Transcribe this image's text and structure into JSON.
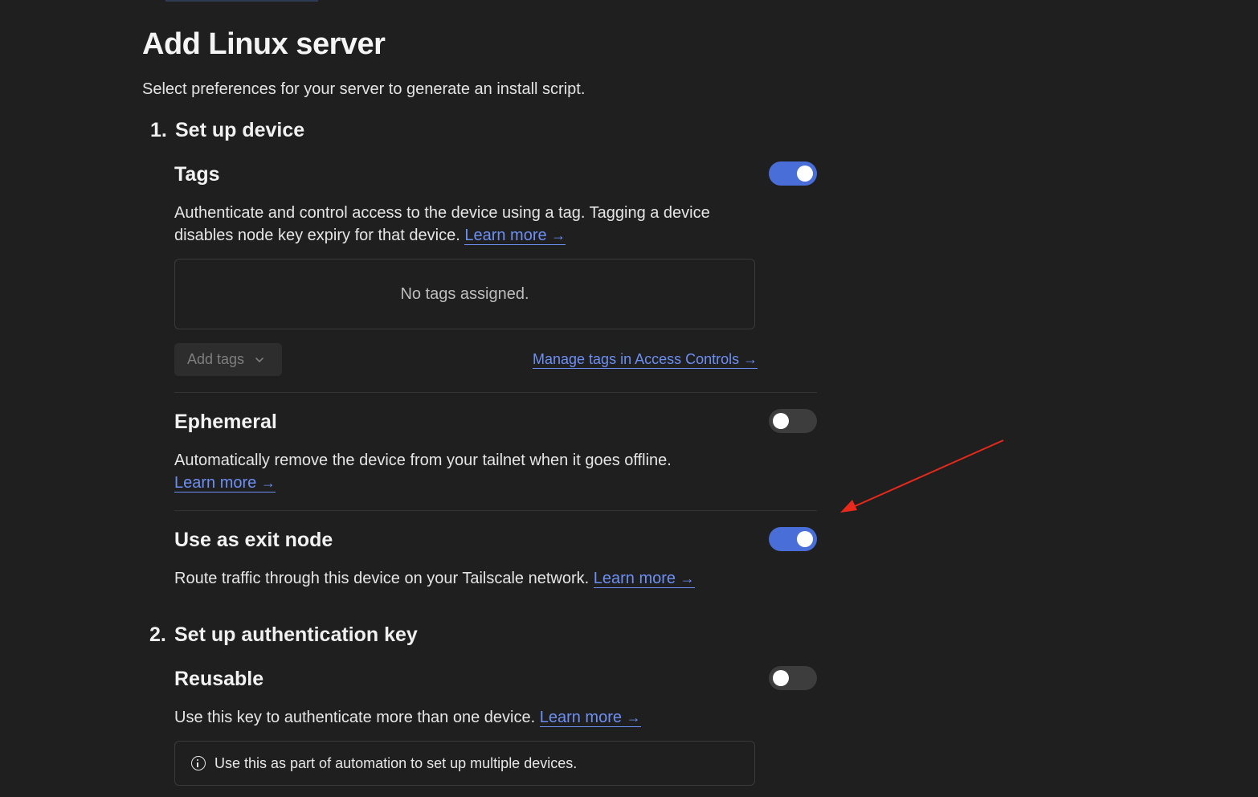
{
  "page": {
    "title": "Add Linux server",
    "subtitle": "Select preferences for your server to generate an install script."
  },
  "step1": {
    "number": "1.",
    "title": "Set up device"
  },
  "tags": {
    "title": "Tags",
    "description": "Authenticate and control access to the device using a tag. Tagging a device disables node key expiry for that device.",
    "learn_more": "Learn more",
    "enabled": true,
    "empty_text": "No tags assigned.",
    "add_button": "Add tags",
    "manage_link": "Manage tags in Access Controls"
  },
  "ephemeral": {
    "title": "Ephemeral",
    "description": "Automatically remove the device from your tailnet when it goes offline.",
    "learn_more": "Learn more",
    "enabled": false
  },
  "exit_node": {
    "title": "Use as exit node",
    "description": "Route traffic through this device on your Tailscale network.",
    "learn_more": "Learn more",
    "enabled": true
  },
  "step2": {
    "number": "2.",
    "title": "Set up authentication key"
  },
  "reusable": {
    "title": "Reusable",
    "description": "Use this key to authenticate more than one device.",
    "learn_more": "Learn more",
    "enabled": false,
    "info_text": "Use this as part of automation to set up multiple devices."
  },
  "icons": {
    "arrow": "arrow-right-icon",
    "chevron": "chevron-down-icon",
    "info": "info-circle-icon",
    "annotation": "red-annotation-arrow"
  },
  "colors": {
    "background": "#1f1f1f",
    "accent": "#4a6ed8",
    "link": "#6d8ff3",
    "toggle_off": "#3d3d3d",
    "annotation": "#e8291c"
  }
}
